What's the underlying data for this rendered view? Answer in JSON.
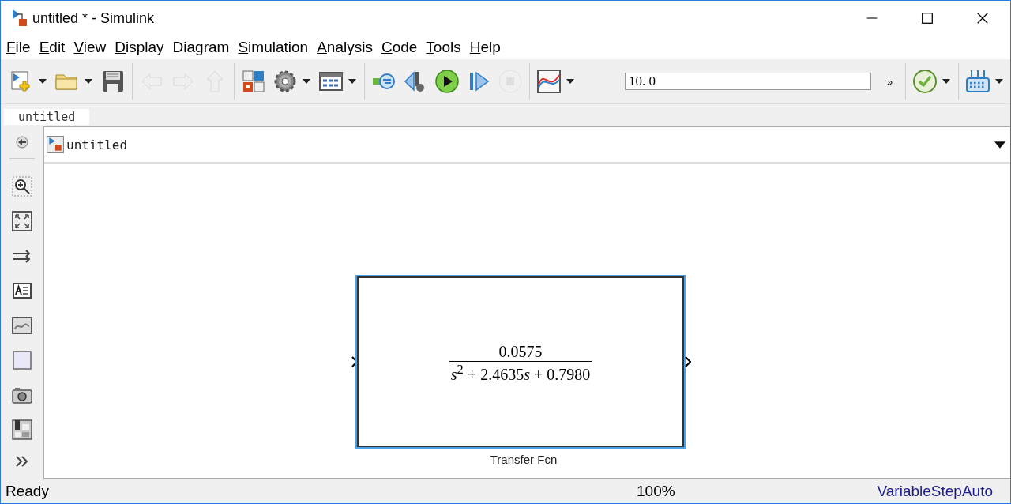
{
  "window": {
    "title": "untitled * - Simulink"
  },
  "menu": [
    {
      "key": "F",
      "after": "ile"
    },
    {
      "key": "E",
      "after": "dit"
    },
    {
      "key": "V",
      "after": "iew"
    },
    {
      "key": "D",
      "after": "isplay"
    },
    {
      "before": "Dia",
      "key": "g",
      "after": "ram"
    },
    {
      "key": "S",
      "after": "imulation"
    },
    {
      "key": "A",
      "after": "nalysis"
    },
    {
      "key": "C",
      "after": "ode"
    },
    {
      "key": "T",
      "after": "ools"
    },
    {
      "key": "H",
      "after": "elp"
    }
  ],
  "toolbar_left": [
    {
      "kind": "new",
      "disabled": false,
      "dropdown": true
    },
    {
      "kind": "open",
      "disabled": false,
      "dropdown": true
    },
    {
      "kind": "save",
      "disabled": false,
      "dropdown": false
    },
    {
      "kind": "separator"
    },
    {
      "kind": "back",
      "disabled": true,
      "dropdown": false
    },
    {
      "kind": "forward",
      "disabled": true,
      "dropdown": false
    },
    {
      "kind": "up",
      "disabled": true,
      "dropdown": false
    },
    {
      "kind": "separator"
    },
    {
      "kind": "library",
      "disabled": false,
      "dropdown": false
    },
    {
      "kind": "settings",
      "disabled": false,
      "dropdown": true
    },
    {
      "kind": "explorer",
      "disabled": false,
      "dropdown": true
    },
    {
      "kind": "separator"
    },
    {
      "kind": "update",
      "disabled": false,
      "dropdown": false
    },
    {
      "kind": "step-back",
      "disabled": false,
      "dropdown": false
    },
    {
      "kind": "run",
      "disabled": false,
      "dropdown": false
    },
    {
      "kind": "step-forward",
      "disabled": false,
      "dropdown": false
    },
    {
      "kind": "stop",
      "disabled": true,
      "dropdown": false
    },
    {
      "kind": "separator"
    },
    {
      "kind": "scope",
      "disabled": false,
      "dropdown": true
    }
  ],
  "stop_time": {
    "value": "10. 0"
  },
  "more_button": "»",
  "toolbar_right": [
    {
      "kind": "separator"
    },
    {
      "kind": "check",
      "disabled": false,
      "dropdown": true
    },
    {
      "kind": "separator"
    },
    {
      "kind": "build",
      "disabled": false,
      "dropdown": true
    }
  ],
  "tabs": [
    {
      "label": "untitled",
      "selected": true
    }
  ],
  "breadcrumb": {
    "label": "untitled"
  },
  "block": {
    "numerator": "0.0575",
    "denominator": [
      "*s*$^{2}$ + 2.4635",
      "*s*",
      "+ 0.7980"
    ],
    "name": "Transfer Fcn",
    "selected": true
  },
  "status_bar": {
    "state": "Ready",
    "zoom": "100%",
    "solver": "VariableStepAuto"
  }
}
